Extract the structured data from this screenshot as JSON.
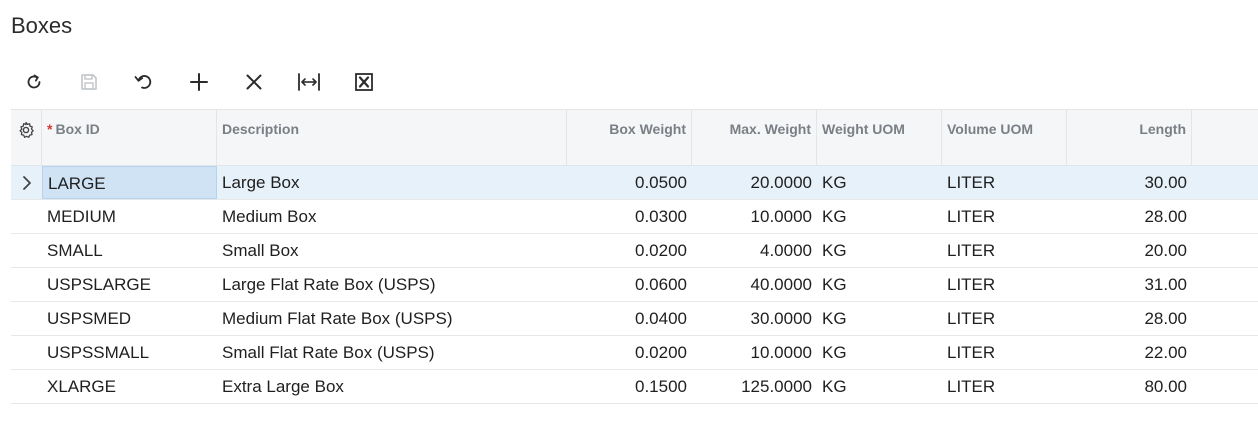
{
  "page": {
    "title": "Boxes"
  },
  "toolbar": {
    "buttons": [
      {
        "name": "refresh-button",
        "icon": "refresh-icon"
      },
      {
        "name": "save-button",
        "icon": "save-icon"
      },
      {
        "name": "undo-button",
        "icon": "undo-icon"
      },
      {
        "name": "add-row-button",
        "icon": "plus-icon"
      },
      {
        "name": "delete-row-button",
        "icon": "close-icon"
      },
      {
        "name": "fit-to-screen-button",
        "icon": "fit-width-icon"
      },
      {
        "name": "export-excel-button",
        "icon": "excel-icon"
      }
    ]
  },
  "grid": {
    "columns": {
      "box_id_required": "*",
      "box_id": "Box ID",
      "description": "Description",
      "box_weight": "Box Weight",
      "max_weight": "Max. Weight",
      "weight_uom": "Weight UOM",
      "volume_uom": "Volume UOM",
      "length": "Length"
    },
    "rows": [
      {
        "box_id": "LARGE",
        "description": "Large Box",
        "box_weight": "0.0500",
        "max_weight": "20.0000",
        "weight_uom": "KG",
        "volume_uom": "LITER",
        "length": "30.00"
      },
      {
        "box_id": "MEDIUM",
        "description": "Medium Box",
        "box_weight": "0.0300",
        "max_weight": "10.0000",
        "weight_uom": "KG",
        "volume_uom": "LITER",
        "length": "28.00"
      },
      {
        "box_id": "SMALL",
        "description": "Small Box",
        "box_weight": "0.0200",
        "max_weight": "4.0000",
        "weight_uom": "KG",
        "volume_uom": "LITER",
        "length": "20.00"
      },
      {
        "box_id": "USPSLARGE",
        "description": "Large Flat Rate Box (USPS)",
        "box_weight": "0.0600",
        "max_weight": "40.0000",
        "weight_uom": "KG",
        "volume_uom": "LITER",
        "length": "31.00"
      },
      {
        "box_id": "USPSMED",
        "description": "Medium Flat Rate Box (USPS)",
        "box_weight": "0.0400",
        "max_weight": "30.0000",
        "weight_uom": "KG",
        "volume_uom": "LITER",
        "length": "28.00"
      },
      {
        "box_id": "USPSSMALL",
        "description": "Small Flat Rate Box (USPS)",
        "box_weight": "0.0200",
        "max_weight": "10.0000",
        "weight_uom": "KG",
        "volume_uom": "LITER",
        "length": "22.00"
      },
      {
        "box_id": "XLARGE",
        "description": "Extra Large Box",
        "box_weight": "0.1500",
        "max_weight": "125.0000",
        "weight_uom": "KG",
        "volume_uom": "LITER",
        "length": "80.00"
      }
    ]
  },
  "colors": {
    "selected_row": "#e6f1fa",
    "active_cell": "#cfe3f5",
    "required_marker": "#d9392f",
    "header_text": "#7a7f85"
  }
}
